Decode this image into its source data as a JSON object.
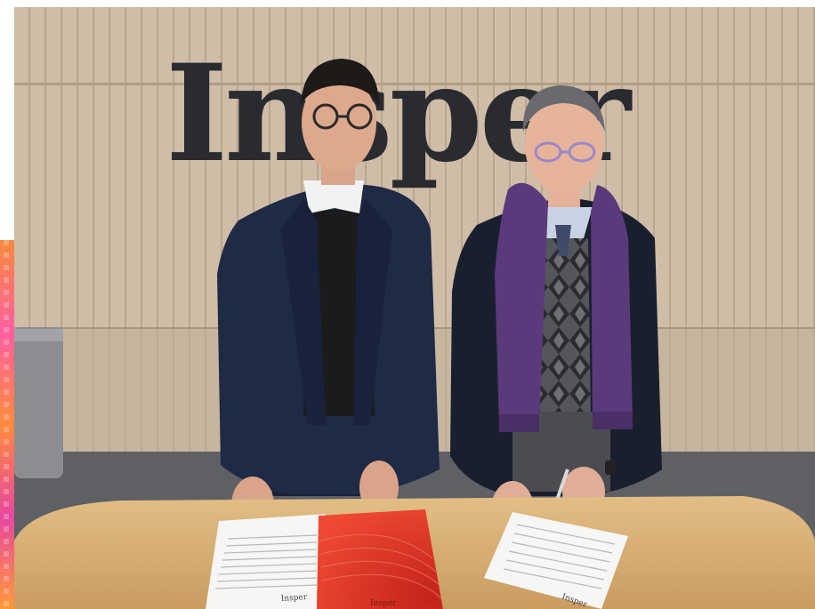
{
  "photo": {
    "wall_sign": "Insper",
    "document_mark_left": "Insper",
    "document_mark_right": "Insper",
    "folder_mark": "Insper"
  },
  "colors": {
    "wall": "#cdbba6",
    "wall_lower": "#bfae98",
    "floor": "#5e6064",
    "table": "#d8b27a",
    "folder": "#e23424",
    "scarf": "#5a3a7a",
    "suit": "#1f2a44"
  }
}
